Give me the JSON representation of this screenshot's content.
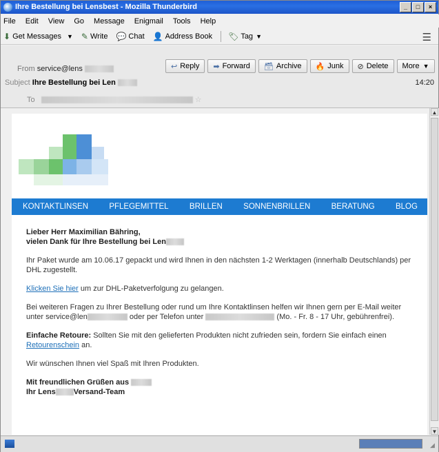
{
  "window": {
    "title": "Ihre Bestellung bei Lensbest - Mozilla Thunderbird",
    "controls": [
      "_",
      "□",
      "×"
    ]
  },
  "menu": {
    "items": [
      "File",
      "Edit",
      "View",
      "Go",
      "Message",
      "Enigmail",
      "Tools",
      "Help"
    ]
  },
  "toolbar": {
    "get_messages": "Get Messages",
    "write": "Write",
    "chat": "Chat",
    "address_book": "Address Book",
    "tag": "Tag"
  },
  "header": {
    "from_label": "From",
    "from_value": "service@lens",
    "subject_label": "Subject",
    "subject_value": "Ihre Bestellung bei Len",
    "to_label": "To",
    "time": "14:20",
    "buttons": {
      "reply": "Reply",
      "forward": "Forward",
      "archive": "Archive",
      "junk": "Junk",
      "delete": "Delete",
      "more": "More"
    }
  },
  "nav": {
    "items": [
      "KONTAKTLINSEN",
      "PFLEGEMITTEL",
      "BRILLEN",
      "SONNENBRILLEN",
      "BERATUNG",
      "BLOG"
    ]
  },
  "email": {
    "greeting_line1": "Lieber Herr Maximilian Bähring,",
    "greeting_line2": "vielen Dank für Ihre Bestellung bei Len",
    "para_shipping": "Ihr Paket wurde am 10.06.17 gepackt und wird Ihnen in den nächsten 1-2 Werktagen (innerhalb Deutschlands) per DHL zugestellt.",
    "tracking_link": "Klicken Sie hier",
    "tracking_rest": " um zur DHL-Paketverfolgung zu gelangen.",
    "questions_1": "Bei weiteren Fragen zu Ihrer Bestellung oder rund um Ihre Kontaktlinsen helfen wir Ihnen gern per E-Mail weiter unter service@len",
    "questions_2": " oder per Telefon unter ",
    "questions_3": " (Mo. - Fr. 8 - 17 Uhr, gebührenfrei).",
    "returns_label": "Einfache Retoure:",
    "returns_text": " Sollten Sie mit den gelieferten Produkten nicht zufrieden sein, fordern Sie einfach einen ",
    "returns_link": "Retourenschein",
    "returns_end": " an.",
    "wish": "Wir wünschen Ihnen viel Spaß mit Ihren Produkten.",
    "sign1": "Mit freundlichen Grüßen aus",
    "sign2a": "Ihr Lens",
    "sign2b": "Versand-Team"
  }
}
